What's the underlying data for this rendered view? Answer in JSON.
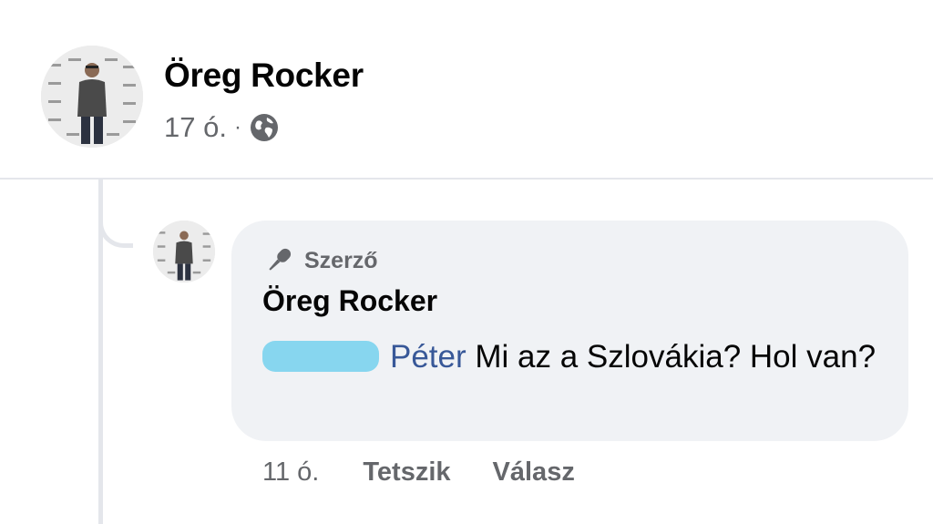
{
  "post": {
    "author": "Öreg Rocker",
    "time": "17 ó.",
    "separator": "·",
    "privacy_icon": "globe-icon"
  },
  "comment": {
    "badge_icon": "microphone-icon",
    "badge_label": "Szerző",
    "author": "Öreg Rocker",
    "mention": "Péter",
    "text": " Mi az a Szlovákia? Hol van?",
    "time": "11 ó.",
    "like_label": "Tetszik",
    "reply_label": "Válasz"
  },
  "colors": {
    "background": "#ffffff",
    "bubble": "#f0f2f5",
    "secondary_text": "#65676b",
    "mention": "#385898",
    "redaction": "#87d6ef"
  }
}
